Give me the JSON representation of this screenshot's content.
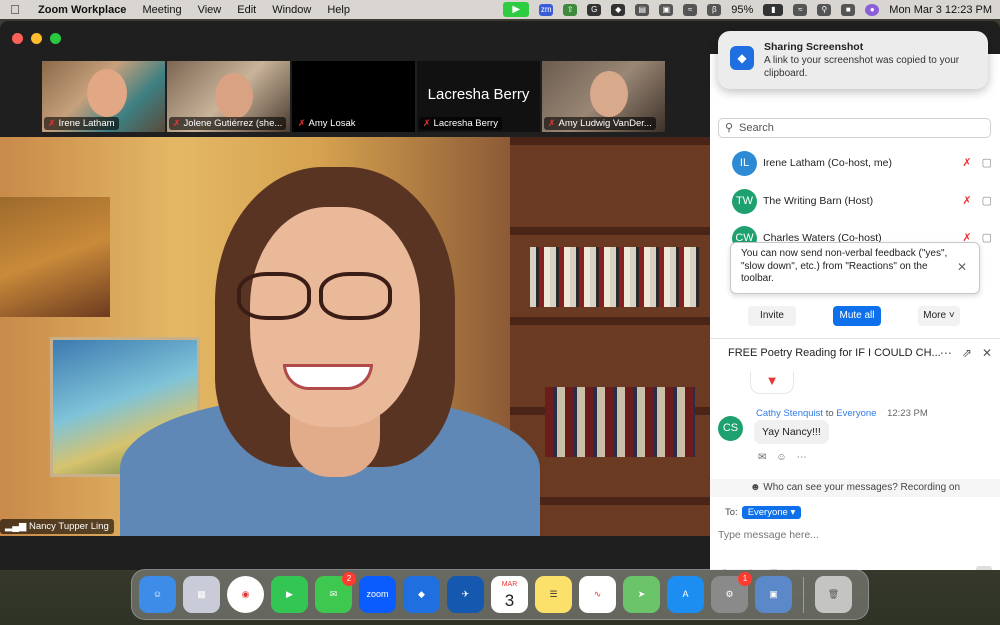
{
  "menubar": {
    "app_name": "Zoom Workplace",
    "menus": [
      "Meeting",
      "View",
      "Edit",
      "Window",
      "Help"
    ],
    "battery": "95%",
    "datetime": "Mon Mar 3  12:23 PM"
  },
  "gallery": [
    {
      "name": "Irene Latham"
    },
    {
      "name": "Jolene Gutiérrez (she..."
    },
    {
      "name": "Amy Losak"
    },
    {
      "name": "Lacresha Berry",
      "big_label": "Lacresha Berry"
    },
    {
      "name": "Amy Ludwig VanDer..."
    }
  ],
  "main_video": {
    "name": "Nancy Tupper Ling"
  },
  "notification": {
    "title": "Sharing Screenshot",
    "body": "A link to your screenshot was copied to your clipboard."
  },
  "participants_panel": {
    "search_placeholder": "Search",
    "participants": [
      {
        "initials": "IL",
        "name": "Irene Latham (Co-host, me)",
        "color": "#2d8bd6"
      },
      {
        "initials": "TW",
        "name": "The Writing Barn (Host)",
        "color": "#1ea16f"
      },
      {
        "initials": "CW",
        "name": "Charles Waters (Co-host)",
        "color": "#1ea16f"
      }
    ],
    "tooltip": "You can now send non-verbal feedback (\"yes\", \"slow down\", etc.) from \"Reactions\" on the toolbar.",
    "buttons": {
      "invite": "Invite",
      "mute_all": "Mute all",
      "more": "More"
    }
  },
  "chat": {
    "title": "FREE Poetry Reading for  IF I COULD CH...",
    "message": {
      "initials": "CS",
      "sender": "Cathy Stenquist",
      "to_word": "to",
      "recipient": "Everyone",
      "time": "12:23 PM",
      "text": "Yay Nancy!!!"
    },
    "visibility_note": "Who can see your messages? Recording on",
    "to_label": "To:",
    "to_value": "Everyone",
    "input_placeholder": "Type message here..."
  },
  "dock": {
    "messages_badge": "2",
    "calendar_month": "MAR",
    "calendar_day": "3",
    "settings_badge": "1",
    "zoom_label": "zoom"
  }
}
